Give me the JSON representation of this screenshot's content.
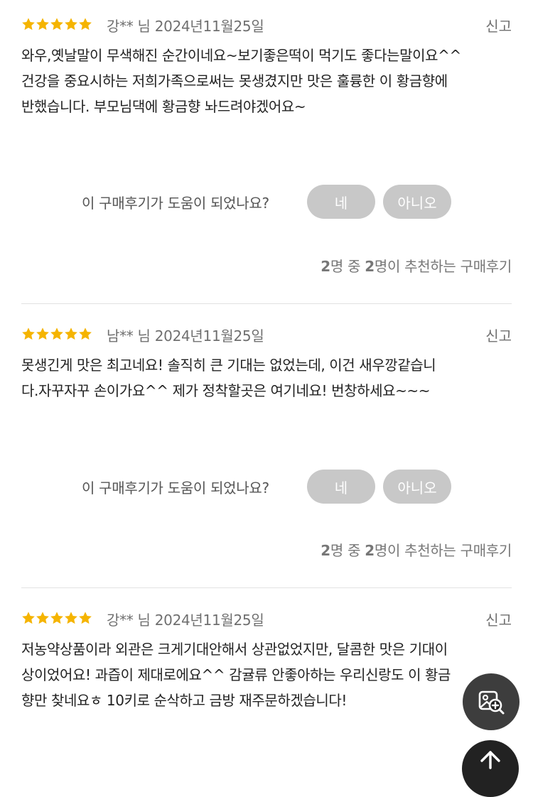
{
  "reviews": [
    {
      "rating": 5,
      "author": "강** 님",
      "date": "2024년11월25일",
      "report_label": "신고",
      "lines": [
        "와우,옛날말이 무색해진 순간이네요~보기좋은떡이 먹기도 좋다는말이요^^",
        "건강을 중요시하는 저희가족으로써는 못생겼지만 맛은 훌륭한 이 황금향에",
        "반했습니다. 부모님댁에 황금향 놔드려야겠어요~"
      ],
      "helpful_question": "이 구매후기가 도움이 되었나요?",
      "yes_label": "네",
      "no_label": "아니오",
      "rec_count": "2",
      "rec_total": "2",
      "rec_text_a": "명 중 ",
      "rec_text_b": "명이 추천하는 구매후기"
    },
    {
      "rating": 5,
      "author": "남** 님",
      "date": "2024년11월25일",
      "report_label": "신고",
      "lines": [
        "못생긴게 맛은 최고네요! 솔직히 큰 기대는 없었는데, 이건 새우깡같습니",
        "다.자꾸자꾸 손이가요^^ 제가 정착할곳은 여기네요! 번창하세요~~~"
      ],
      "helpful_question": "이 구매후기가 도움이 되었나요?",
      "yes_label": "네",
      "no_label": "아니오",
      "rec_count": "2",
      "rec_total": "2",
      "rec_text_a": "명 중 ",
      "rec_text_b": "명이 추천하는 구매후기"
    },
    {
      "rating": 5,
      "author": "강** 님",
      "date": "2024년11월25일",
      "report_label": "신고",
      "lines": [
        "저농약상품이라 외관은 크게기대안해서 상관없었지만, 달콤한 맛은 기대이",
        "상이었어요! 과즙이 제대로에요^^ 감귤류 안좋아하는 우리신랑도 이 황금",
        "향만 찾네요ㅎ 10키로 순삭하고 금방 재주문하겠습니다!"
      ]
    }
  ],
  "colors": {
    "star": "#F5B400",
    "button_bg": "#C8C8C8",
    "fab_bg": "#222222"
  },
  "icons": {
    "rating": "star-icon",
    "image_search": "image-search-icon",
    "top": "arrow-up-icon"
  }
}
